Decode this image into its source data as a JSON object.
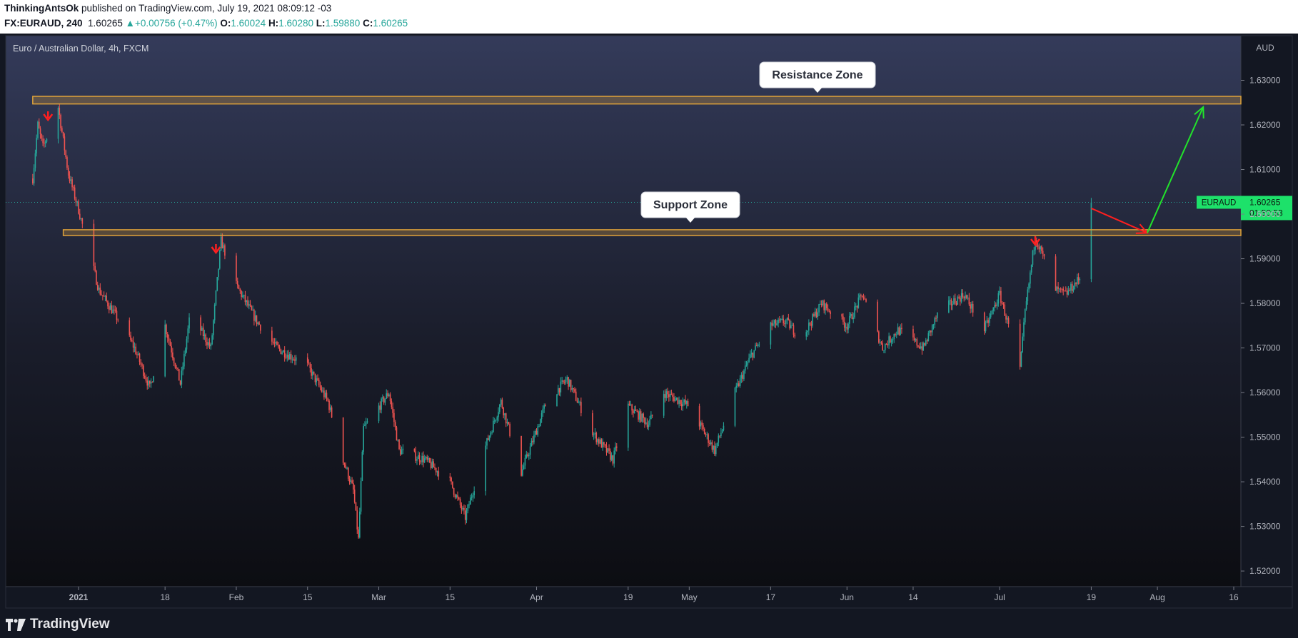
{
  "header": {
    "author": "ThinkingAntsOk",
    "published_text": " published on TradingView.com, July 19, 2021 08:09:12 -03",
    "symbol": "FX:EURAUD, 240",
    "price": "1.60265",
    "change": "+0.00756 (+0.47%)",
    "o_label": "O:",
    "o": "1.60024",
    "h_label": "H:",
    "h": "1.60280",
    "l_label": "L:",
    "l": "1.59880",
    "c_label": "C:",
    "c": "1.60265"
  },
  "footer": {
    "brand": "TradingView"
  },
  "colors": {
    "up": "#26a69a",
    "down": "#ef5350",
    "zone": "#e0a33a",
    "arrow_up": "#22e32b",
    "arrow_down": "#ff1f1f",
    "price_tag": "#1de16a"
  },
  "chart_data": {
    "type": "candlestick",
    "title": "Euro / Australian Dollar, 4h, FXCM",
    "currency": "AUD",
    "y_ticks": [
      "1.63000",
      "1.62000",
      "1.61000",
      "1.60000",
      "1.59000",
      "1.58000",
      "1.57000",
      "1.56000",
      "1.55000",
      "1.54000",
      "1.53000",
      "1.52000"
    ],
    "ylim": [
      1.5165,
      1.64
    ],
    "x_ticks": [
      "2021",
      "18",
      "Feb",
      "15",
      "Mar",
      "15",
      "Apr",
      "19",
      "May",
      "17",
      "Jun",
      "14",
      "Jul",
      "19",
      "Aug",
      "16"
    ],
    "x_tick_dates": [
      "2021-01-01",
      "2021-01-18",
      "2021-02-01",
      "2021-02-15",
      "2021-03-01",
      "2021-03-15",
      "2021-04-01",
      "2021-04-19",
      "2021-05-01",
      "2021-05-17",
      "2021-06-01",
      "2021-06-14",
      "2021-07-01",
      "2021-07-19",
      "2021-08-01",
      "2021-08-16"
    ],
    "series": [
      {
        "path_dates": [
          "2020-12-23",
          "2020-12-24",
          "2020-12-25",
          "2020-12-28",
          "2020-12-30",
          "2021-01-01",
          "2021-01-05",
          "2021-01-09",
          "2021-01-12",
          "2021-01-15",
          "2021-01-18",
          "2021-01-21",
          "2021-01-23",
          "2021-01-27",
          "2021-01-29",
          "2021-02-01",
          "2021-02-05",
          "2021-02-09",
          "2021-02-15",
          "2021-02-19",
          "2021-02-22",
          "2021-02-24",
          "2021-02-25",
          "2021-02-26",
          "2021-03-03",
          "2021-03-05",
          "2021-03-10",
          "2021-03-15",
          "2021-03-18",
          "2021-03-22",
          "2021-03-25",
          "2021-03-29",
          "2021-04-03",
          "2021-04-07",
          "2021-04-12",
          "2021-04-16",
          "2021-04-19",
          "2021-04-23",
          "2021-04-26",
          "2021-05-01",
          "2021-05-06",
          "2021-05-10",
          "2021-05-13",
          "2021-05-17",
          "2021-05-20",
          "2021-05-23",
          "2021-05-27",
          "2021-06-01",
          "2021-06-04",
          "2021-06-08",
          "2021-06-11",
          "2021-06-16",
          "2021-06-19",
          "2021-06-24",
          "2021-06-28",
          "2021-07-01",
          "2021-07-03",
          "2021-07-05",
          "2021-07-06",
          "2021-07-08",
          "2021-07-10",
          "2021-07-12",
          "2021-07-14",
          "2021-07-17",
          "2021-07-19"
        ],
        "path_values": [
          1.608,
          1.62,
          1.615,
          1.624,
          1.609,
          1.601,
          1.583,
          1.576,
          1.57,
          1.561,
          1.575,
          1.562,
          1.578,
          1.57,
          1.594,
          1.584,
          1.576,
          1.57,
          1.566,
          1.558,
          1.545,
          1.538,
          1.527,
          1.552,
          1.56,
          1.547,
          1.545,
          1.54,
          1.532,
          1.548,
          1.558,
          1.542,
          1.558,
          1.563,
          1.551,
          1.545,
          1.557,
          1.553,
          1.56,
          1.557,
          1.547,
          1.56,
          1.568,
          1.575,
          1.576,
          1.572,
          1.58,
          1.575,
          1.582,
          1.57,
          1.574,
          1.57,
          1.578,
          1.582,
          1.574,
          1.582,
          1.574,
          1.565,
          1.578,
          1.595,
          1.589,
          1.583,
          1.582,
          1.586,
          1.6026
        ]
      }
    ],
    "last_price": "1.60265",
    "price_tag_symbol": "EURAUD",
    "countdown": "01:50:53",
    "annotations": [
      {
        "label": "Resistance Zone",
        "type": "zone",
        "y_range": [
          1.6247,
          1.6264
        ],
        "start_date": "2020-12-23"
      },
      {
        "label": "Support Zone",
        "type": "zone",
        "y_range": [
          1.5952,
          1.5965
        ],
        "start_date": "2020-12-29"
      },
      {
        "type": "down-arrow-marker",
        "date": "2020-12-26"
      },
      {
        "type": "down-arrow-marker",
        "date": "2021-01-28"
      },
      {
        "type": "down-arrow-marker",
        "date": "2021-07-08"
      },
      {
        "type": "projection-down",
        "from_date": "2021-07-19",
        "from_value": 1.6013,
        "to_date": "2021-07-30",
        "to_value": 1.5958
      },
      {
        "type": "projection-up",
        "from_date": "2021-07-30",
        "from_value": 1.5958,
        "to_date": "2021-08-10",
        "to_value": 1.624
      }
    ]
  }
}
